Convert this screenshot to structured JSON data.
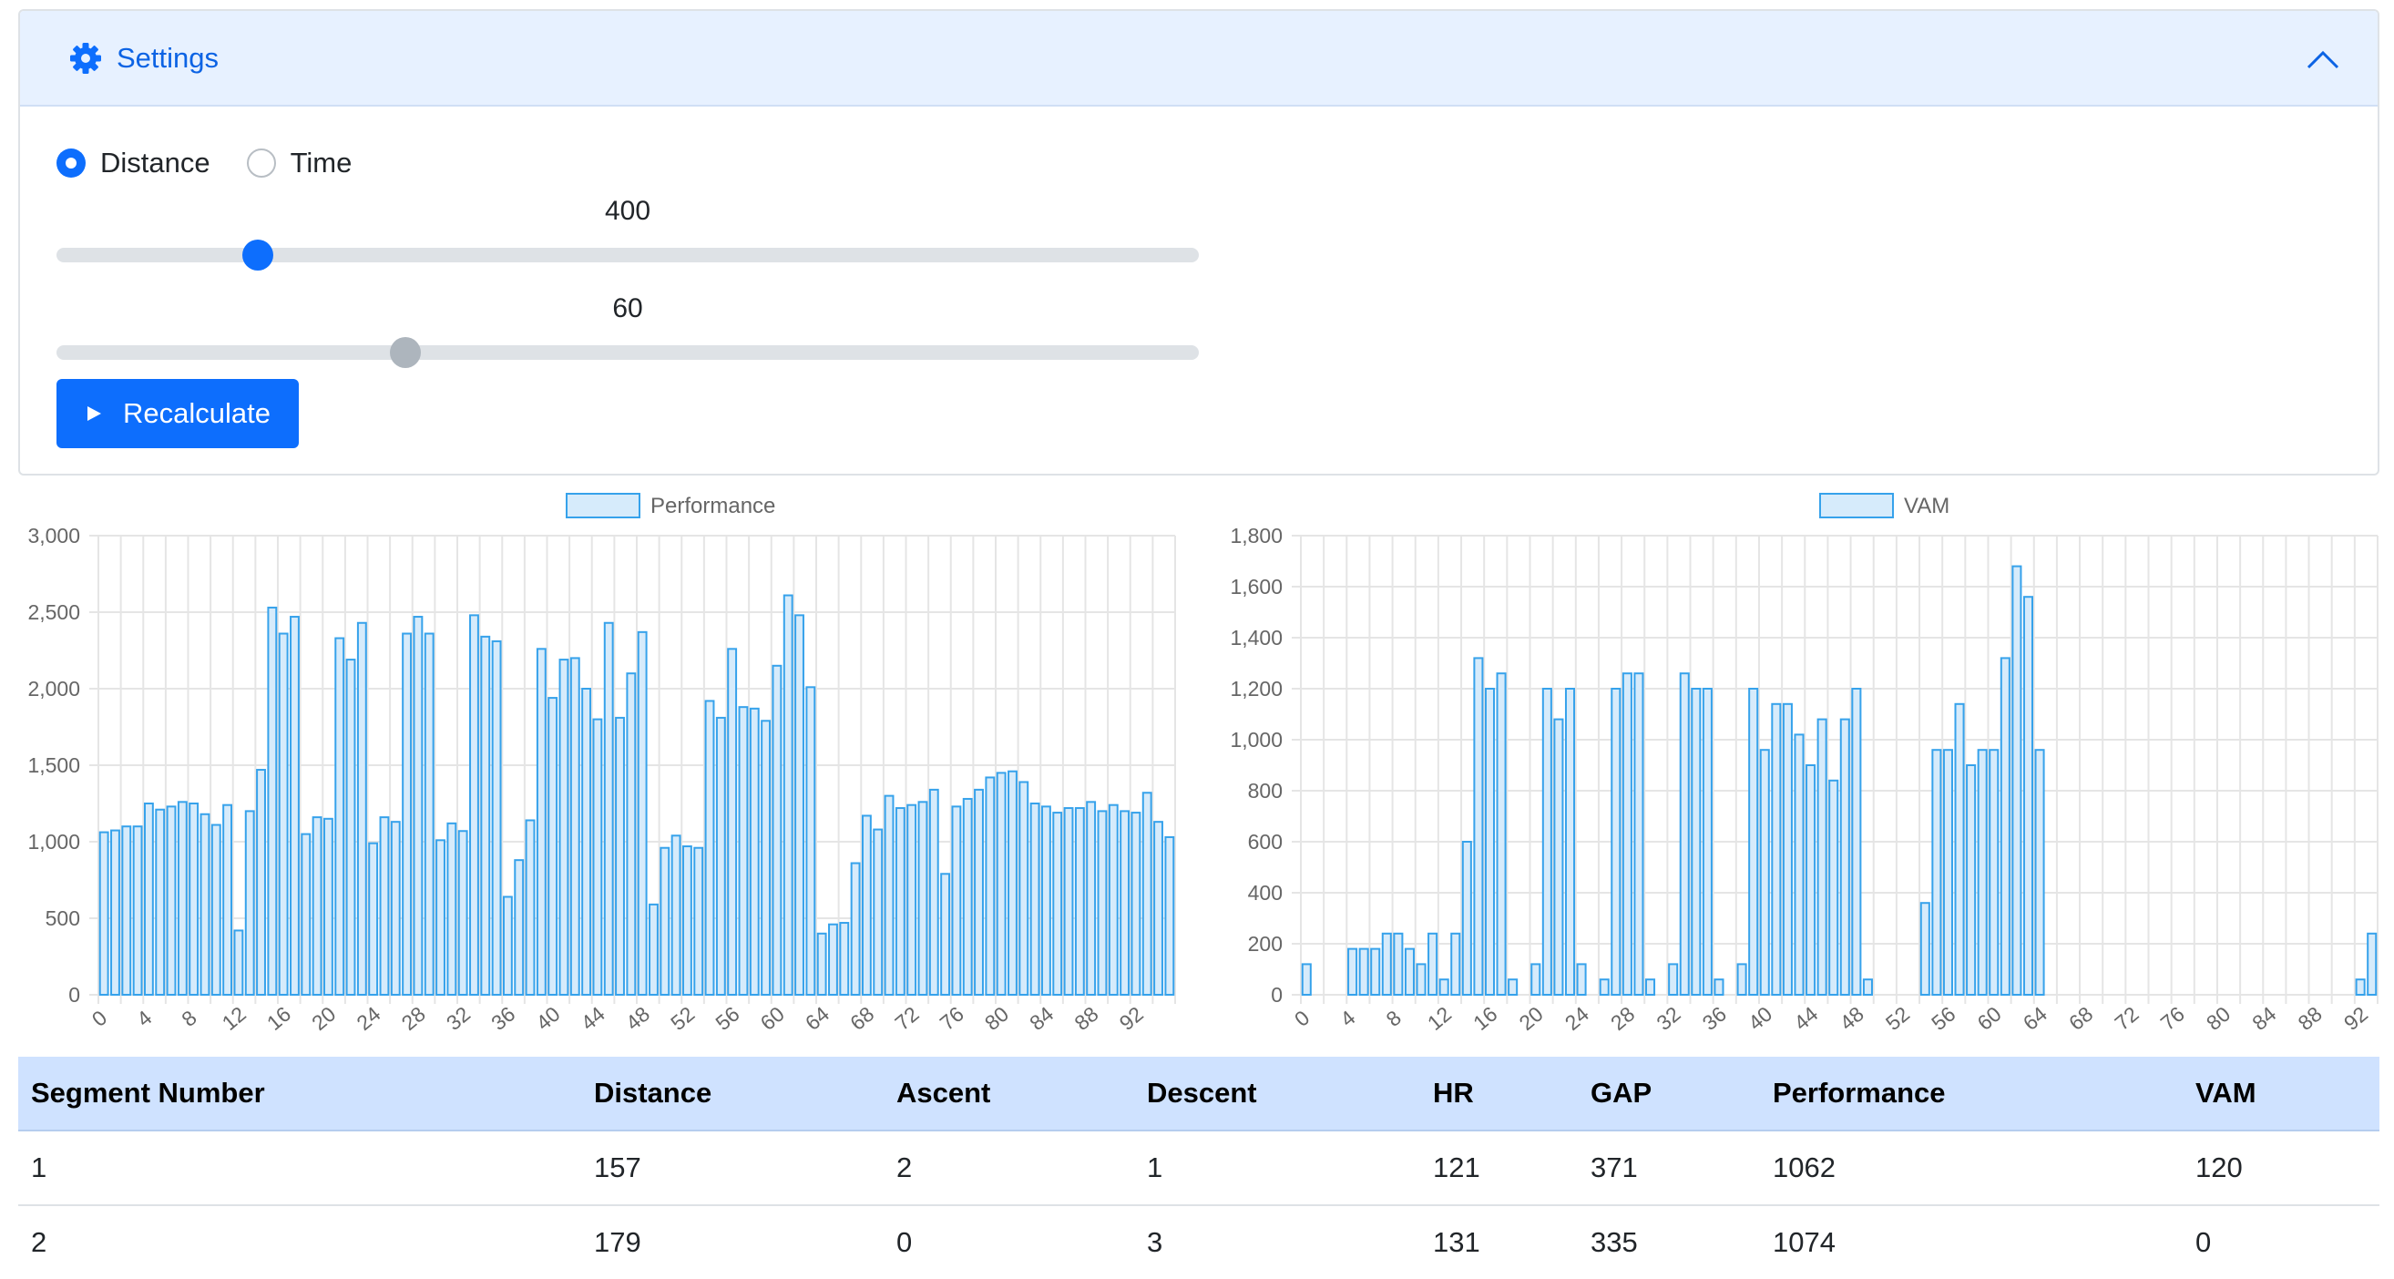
{
  "settings": {
    "title": "Settings",
    "mode_options": [
      {
        "label": "Distance",
        "selected": true
      },
      {
        "label": "Time",
        "selected": false
      }
    ],
    "slider1": {
      "value_label": "400",
      "fraction": 0.167
    },
    "slider2": {
      "value_label": "60",
      "fraction": 0.3
    },
    "recalculate_label": "Recalculate"
  },
  "colors": {
    "accent": "#0d6efd",
    "bar_fill": "#d6ebfb",
    "bar_stroke": "#36a2eb",
    "header_bg": "#e7f1ff",
    "table_header_bg": "#cfe2ff"
  },
  "chart_data": [
    {
      "type": "bar",
      "legend": "Performance",
      "ylim": [
        0,
        3000
      ],
      "yticks": [
        0,
        500,
        1000,
        1500,
        2000,
        2500,
        3000
      ],
      "ytick_labels": [
        "0",
        "500",
        "1,000",
        "1,500",
        "2,000",
        "2,500",
        "3,000"
      ],
      "x": [
        0,
        1,
        2,
        3,
        4,
        5,
        6,
        7,
        8,
        9,
        10,
        11,
        12,
        13,
        14,
        15,
        16,
        17,
        18,
        19,
        20,
        21,
        22,
        23,
        24,
        25,
        26,
        27,
        28,
        29,
        30,
        31,
        32,
        33,
        34,
        35,
        36,
        37,
        38,
        39,
        40,
        41,
        42,
        43,
        44,
        45,
        46,
        47,
        48,
        49,
        50,
        51,
        52,
        53,
        54,
        55,
        56,
        57,
        58,
        59,
        60,
        61,
        62,
        63,
        64,
        65,
        66,
        67,
        68,
        69,
        70,
        71,
        72,
        73,
        74,
        75,
        76,
        77,
        78,
        79,
        80,
        81,
        82,
        83,
        84,
        85,
        86,
        87,
        88,
        89,
        90,
        91,
        92,
        93,
        94,
        95
      ],
      "xtick_labels": [
        "0",
        "4",
        "8",
        "12",
        "16",
        "20",
        "24",
        "28",
        "32",
        "36",
        "40",
        "44",
        "48",
        "52",
        "56",
        "60",
        "64",
        "68",
        "72",
        "76",
        "80",
        "84",
        "88",
        "92"
      ],
      "values": [
        1062,
        1074,
        1100,
        1100,
        1250,
        1210,
        1230,
        1260,
        1250,
        1180,
        1110,
        1240,
        420,
        1200,
        1470,
        2530,
        2360,
        2470,
        1050,
        1160,
        1150,
        2330,
        2190,
        2430,
        990,
        1160,
        1130,
        2360,
        2470,
        2360,
        1010,
        1120,
        1070,
        2480,
        2340,
        2310,
        640,
        880,
        1140,
        2260,
        1940,
        2190,
        2200,
        2000,
        1800,
        2430,
        1810,
        2100,
        2370,
        590,
        960,
        1040,
        970,
        960,
        1920,
        1810,
        2260,
        1880,
        1870,
        1790,
        2150,
        2610,
        2480,
        2010,
        400,
        460,
        470,
        860,
        1170,
        1080,
        1300,
        1220,
        1240,
        1260,
        1340,
        790,
        1230,
        1280,
        1340,
        1420,
        1450,
        1460,
        1390,
        1250,
        1230,
        1190,
        1220,
        1220,
        1260,
        1200,
        1240,
        1200,
        1190,
        1320,
        1130,
        1030
      ]
    },
    {
      "type": "bar",
      "legend": "VAM",
      "ylim": [
        0,
        1800
      ],
      "yticks": [
        0,
        200,
        400,
        600,
        800,
        1000,
        1200,
        1400,
        1600,
        1800
      ],
      "ytick_labels": [
        "0",
        "200",
        "400",
        "600",
        "800",
        "1,000",
        "1,200",
        "1,400",
        "1,600",
        "1,800"
      ],
      "x": [
        0,
        1,
        2,
        3,
        4,
        5,
        6,
        7,
        8,
        9,
        10,
        11,
        12,
        13,
        14,
        15,
        16,
        17,
        18,
        19,
        20,
        21,
        22,
        23,
        24,
        25,
        26,
        27,
        28,
        29,
        30,
        31,
        32,
        33,
        34,
        35,
        36,
        37,
        38,
        39,
        40,
        41,
        42,
        43,
        44,
        45,
        46,
        47,
        48,
        49,
        50,
        51,
        52,
        53,
        54,
        55,
        56,
        57,
        58,
        59,
        60,
        61,
        62,
        63,
        64,
        65,
        66,
        67,
        68,
        69,
        70,
        71,
        72,
        73,
        74,
        75,
        76,
        77,
        78,
        79,
        80,
        81,
        82,
        83,
        84,
        85,
        86,
        87,
        88,
        89,
        90,
        91,
        92,
        93
      ],
      "xtick_labels": [
        "0",
        "4",
        "8",
        "12",
        "16",
        "20",
        "24",
        "28",
        "32",
        "36",
        "40",
        "44",
        "48",
        "52",
        "56",
        "60",
        "64",
        "68",
        "72",
        "76",
        "80",
        "84",
        "88",
        "92"
      ],
      "values": [
        120,
        0,
        0,
        0,
        180,
        180,
        180,
        240,
        240,
        180,
        120,
        240,
        60,
        240,
        600,
        1320,
        1200,
        1260,
        60,
        0,
        120,
        1200,
        1080,
        1200,
        120,
        0,
        60,
        1200,
        1260,
        1260,
        60,
        0,
        120,
        1260,
        1200,
        1200,
        60,
        0,
        120,
        1200,
        960,
        1140,
        1140,
        1020,
        900,
        1080,
        840,
        1080,
        1200,
        60,
        0,
        0,
        0,
        0,
        360,
        960,
        960,
        1140,
        900,
        960,
        960,
        1320,
        1680,
        1560,
        960,
        0,
        0,
        0,
        0,
        0,
        0,
        0,
        0,
        0,
        0,
        0,
        0,
        0,
        0,
        0,
        0,
        0,
        0,
        0,
        0,
        0,
        0,
        0,
        0,
        0,
        0,
        0,
        60,
        240
      ]
    }
  ],
  "table": {
    "headers": [
      "Segment Number",
      "Distance",
      "Ascent",
      "Descent",
      "HR",
      "GAP",
      "Performance",
      "VAM"
    ],
    "rows": [
      [
        "1",
        "157",
        "2",
        "1",
        "121",
        "371",
        "1062",
        "120"
      ],
      [
        "2",
        "179",
        "0",
        "3",
        "131",
        "335",
        "1074",
        "0"
      ]
    ]
  }
}
